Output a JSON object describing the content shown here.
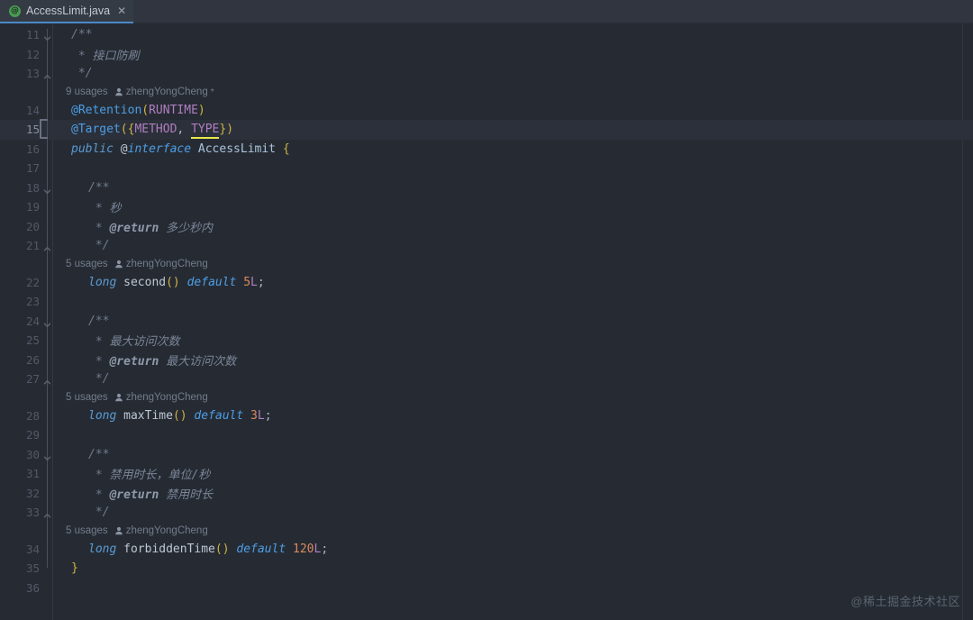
{
  "window": {
    "background": "#262b33",
    "accent": "#4a88c7"
  },
  "tabbar": {
    "tabs": [
      {
        "label": "AccessLimit.java",
        "icon": "annotation-class-icon",
        "icon_glyph": "@",
        "close_glyph": "✕",
        "active": true
      }
    ]
  },
  "editor": {
    "language": "java",
    "file_name": "AccessLimit.java",
    "first_visible_line": 11,
    "last_visible_line": 36,
    "caret_line": 15,
    "lines": [
      {
        "num": 11,
        "indent": 1,
        "tokens": [
          {
            "t": "/**",
            "c": "cmt"
          }
        ]
      },
      {
        "num": 12,
        "indent": 1,
        "tokens": [
          {
            "t": " * ",
            "c": "cmt"
          },
          {
            "t": "接口防刷",
            "c": "cmt-cn"
          }
        ]
      },
      {
        "num": 13,
        "indent": 1,
        "tokens": [
          {
            "t": " */",
            "c": "cmt"
          }
        ]
      },
      {
        "num": 14,
        "indent": 1,
        "tokens": [
          {
            "t": "@Retention",
            "c": "anno"
          },
          {
            "t": "(",
            "c": "paren"
          },
          {
            "t": "RUNTIME",
            "c": "sfield"
          },
          {
            "t": ")",
            "c": "paren"
          }
        ]
      },
      {
        "num": 15,
        "indent": 1,
        "tokens": [
          {
            "t": "@Target",
            "c": "anno"
          },
          {
            "t": "(",
            "c": "paren"
          },
          {
            "t": "{",
            "c": "brace"
          },
          {
            "t": "METHOD",
            "c": "sfield"
          },
          {
            "t": ", ",
            "c": "punct"
          },
          {
            "t": "TYPE",
            "c": "sfield",
            "warn": true
          },
          {
            "t": "}",
            "c": "brace"
          },
          {
            "t": ")",
            "c": "paren"
          }
        ]
      },
      {
        "num": 16,
        "indent": 1,
        "tokens": [
          {
            "t": "public ",
            "c": "kw"
          },
          {
            "t": "@",
            "c": "ident"
          },
          {
            "t": "interface",
            "c": "kw2"
          },
          {
            "t": " ",
            "c": "punct"
          },
          {
            "t": "AccessLimit",
            "c": "type"
          },
          {
            "t": " ",
            "c": "punct"
          },
          {
            "t": "{",
            "c": "brace"
          }
        ]
      },
      {
        "num": 17,
        "indent": 0,
        "tokens": []
      },
      {
        "num": 18,
        "indent": 2,
        "tokens": [
          {
            "t": "/**",
            "c": "cmt"
          }
        ]
      },
      {
        "num": 19,
        "indent": 2,
        "tokens": [
          {
            "t": " * ",
            "c": "cmt"
          },
          {
            "t": "秒",
            "c": "cmt-cn"
          }
        ]
      },
      {
        "num": 20,
        "indent": 2,
        "tokens": [
          {
            "t": " * ",
            "c": "cmt"
          },
          {
            "t": "@return",
            "c": "cmt-tag"
          },
          {
            "t": " ",
            "c": "cmt"
          },
          {
            "t": "多少秒内",
            "c": "cmt-cn"
          }
        ]
      },
      {
        "num": 21,
        "indent": 2,
        "tokens": [
          {
            "t": " */",
            "c": "cmt"
          }
        ]
      },
      {
        "num": 22,
        "indent": 2,
        "tokens": [
          {
            "t": "long",
            "c": "kw"
          },
          {
            "t": " ",
            "c": "punct"
          },
          {
            "t": "second",
            "c": "ident"
          },
          {
            "t": "()",
            "c": "paren"
          },
          {
            "t": " ",
            "c": "punct"
          },
          {
            "t": "default",
            "c": "kw2"
          },
          {
            "t": " ",
            "c": "punct"
          },
          {
            "t": "5",
            "c": "num"
          },
          {
            "t": "L",
            "c": "numsuf"
          },
          {
            "t": ";",
            "c": "punct"
          }
        ]
      },
      {
        "num": 23,
        "indent": 0,
        "tokens": []
      },
      {
        "num": 24,
        "indent": 2,
        "tokens": [
          {
            "t": "/**",
            "c": "cmt"
          }
        ]
      },
      {
        "num": 25,
        "indent": 2,
        "tokens": [
          {
            "t": " * ",
            "c": "cmt"
          },
          {
            "t": "最大访问次数",
            "c": "cmt-cn"
          }
        ]
      },
      {
        "num": 26,
        "indent": 2,
        "tokens": [
          {
            "t": " * ",
            "c": "cmt"
          },
          {
            "t": "@return",
            "c": "cmt-tag"
          },
          {
            "t": " ",
            "c": "cmt"
          },
          {
            "t": "最大访问次数",
            "c": "cmt-cn"
          }
        ]
      },
      {
        "num": 27,
        "indent": 2,
        "tokens": [
          {
            "t": " */",
            "c": "cmt"
          }
        ]
      },
      {
        "num": 28,
        "indent": 2,
        "tokens": [
          {
            "t": "long",
            "c": "kw"
          },
          {
            "t": " ",
            "c": "punct"
          },
          {
            "t": "maxTime",
            "c": "ident"
          },
          {
            "t": "()",
            "c": "paren"
          },
          {
            "t": " ",
            "c": "punct"
          },
          {
            "t": "default",
            "c": "kw2"
          },
          {
            "t": " ",
            "c": "punct"
          },
          {
            "t": "3",
            "c": "num"
          },
          {
            "t": "L",
            "c": "numsuf"
          },
          {
            "t": ";",
            "c": "punct"
          }
        ]
      },
      {
        "num": 29,
        "indent": 0,
        "tokens": []
      },
      {
        "num": 30,
        "indent": 2,
        "tokens": [
          {
            "t": "/**",
            "c": "cmt"
          }
        ]
      },
      {
        "num": 31,
        "indent": 2,
        "tokens": [
          {
            "t": " * ",
            "c": "cmt"
          },
          {
            "t": "禁用时长，单位/秒",
            "c": "cmt-cn"
          }
        ]
      },
      {
        "num": 32,
        "indent": 2,
        "tokens": [
          {
            "t": " * ",
            "c": "cmt"
          },
          {
            "t": "@return",
            "c": "cmt-tag"
          },
          {
            "t": " ",
            "c": "cmt"
          },
          {
            "t": "禁用时长",
            "c": "cmt-cn"
          }
        ]
      },
      {
        "num": 33,
        "indent": 2,
        "tokens": [
          {
            "t": " */",
            "c": "cmt"
          }
        ]
      },
      {
        "num": 34,
        "indent": 2,
        "tokens": [
          {
            "t": "long",
            "c": "kw"
          },
          {
            "t": " ",
            "c": "punct"
          },
          {
            "t": "forbiddenTime",
            "c": "ident"
          },
          {
            "t": "()",
            "c": "paren"
          },
          {
            "t": " ",
            "c": "punct"
          },
          {
            "t": "default",
            "c": "kw2"
          },
          {
            "t": " ",
            "c": "punct"
          },
          {
            "t": "120",
            "c": "num"
          },
          {
            "t": "L",
            "c": "numsuf"
          },
          {
            "t": ";",
            "c": "punct"
          }
        ]
      },
      {
        "num": 35,
        "indent": 1,
        "tokens": [
          {
            "t": "}",
            "c": "brace"
          }
        ]
      },
      {
        "num": 36,
        "indent": 0,
        "tokens": []
      }
    ],
    "code_vision": [
      {
        "after_line": 13,
        "usages": "9 usages",
        "author": "zhengYongCheng",
        "star": "*"
      },
      {
        "after_line": 21,
        "usages": "5 usages",
        "author": "zhengYongCheng",
        "star": ""
      },
      {
        "after_line": 27,
        "usages": "5 usages",
        "author": "zhengYongCheng",
        "star": ""
      },
      {
        "after_line": 33,
        "usages": "5 usages",
        "author": "zhengYongCheng",
        "star": ""
      }
    ]
  },
  "watermark": {
    "text": "@稀土掘金技术社区"
  }
}
